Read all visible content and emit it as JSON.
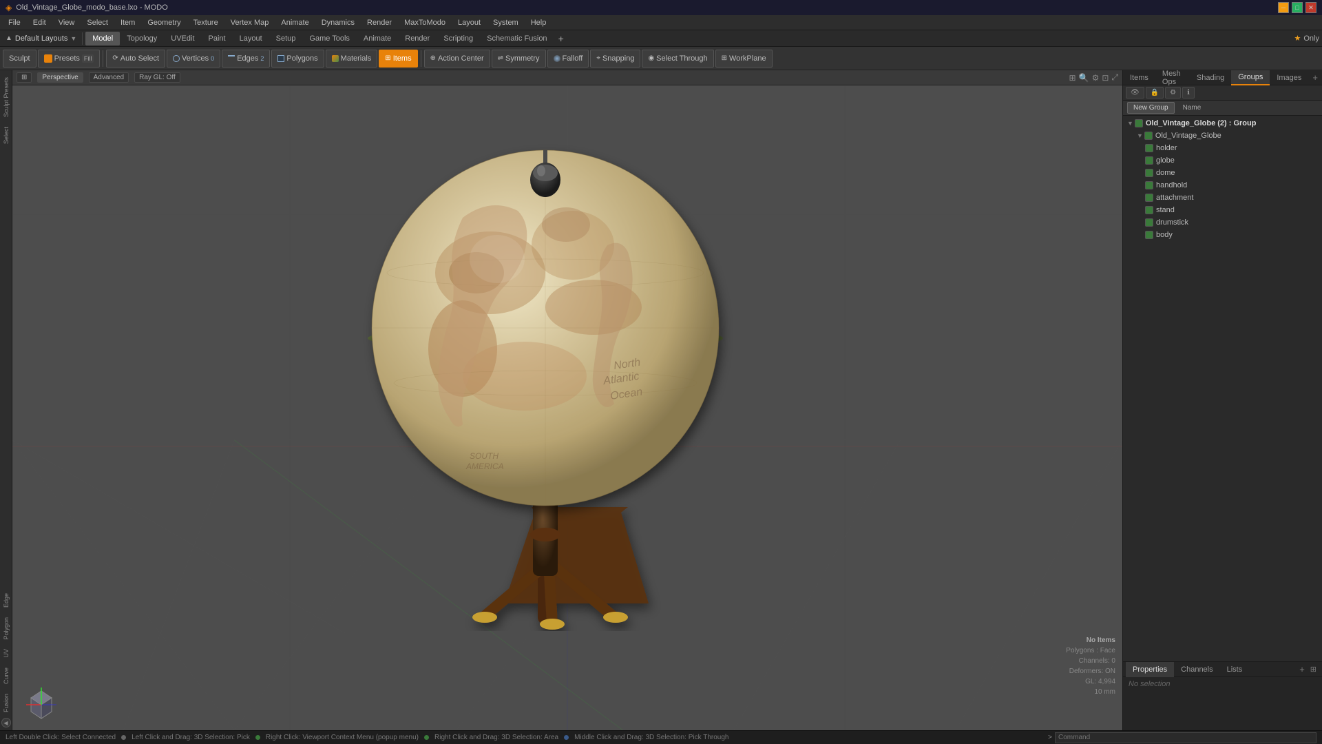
{
  "window": {
    "title": "Old_Vintage_Globe_modo_base.lxo - MODO",
    "min_label": "─",
    "max_label": "□",
    "close_label": "✕"
  },
  "menubar": {
    "items": [
      "File",
      "Edit",
      "View",
      "Select",
      "Item",
      "Geometry",
      "Texture",
      "Vertex Map",
      "Animate",
      "Dynamics",
      "Render",
      "MaxToModo",
      "Layout",
      "System",
      "Help"
    ]
  },
  "layoutbar": {
    "layouts_label": "Default Layouts",
    "tabs": [
      "Model",
      "Topology",
      "UVEdit",
      "Paint",
      "Layout",
      "Setup",
      "Game Tools",
      "Animate",
      "Render",
      "Scripting",
      "Schematic Fusion"
    ],
    "active_tab": "Model",
    "star_label": "★  Only",
    "add_label": "+"
  },
  "toolbar": {
    "sculpt_label": "Sculpt",
    "presets_label": "Presets",
    "presets_extra": "Fill",
    "autoselect_label": "Auto Select",
    "vertices_label": "Vertices",
    "vertices_num": "0",
    "edges_label": "Edges",
    "edges_num": "2",
    "polygons_label": "Polygons",
    "materials_label": "Materials",
    "items_label": "Items",
    "action_center_label": "Action Center",
    "symmetry_label": "Symmetry",
    "falloff_label": "Falloff",
    "snapping_label": "Snapping",
    "select_through_label": "Select Through",
    "workplane_label": "WorkPlane"
  },
  "viewport": {
    "perspective_label": "Perspective",
    "advanced_label": "Advanced",
    "ray_gl_label": "Ray GL: Off"
  },
  "globe": {
    "ocean_text": "North Atlantic Ocean",
    "globe_label": "Old Vintage Globe 3D model"
  },
  "info_overlay": {
    "no_items": "No Items",
    "polygons": "Polygons : Face",
    "channels": "Channels: 0",
    "deformers": "Deformers: ON",
    "gl": "GL: 4,994",
    "unit": "10 mm"
  },
  "right_panel": {
    "tabs": [
      "Items",
      "Mesh Ops",
      "Shading",
      "Groups",
      "Images"
    ],
    "active_tab": "Groups",
    "add_label": "+",
    "new_group_label": "New Group",
    "name_col": "Name",
    "scene_tree": {
      "root": {
        "label": "Old_Vintage_Globe (2) : Group",
        "expanded": true,
        "children": [
          {
            "label": "Old_Vintage_Globe",
            "indent": 1,
            "eye": true
          },
          {
            "label": "holder",
            "indent": 2,
            "eye": true
          },
          {
            "label": "globe",
            "indent": 2,
            "eye": true
          },
          {
            "label": "dome",
            "indent": 2,
            "eye": true
          },
          {
            "label": "handhold",
            "indent": 2,
            "eye": true
          },
          {
            "label": "attachment",
            "indent": 2,
            "eye": true
          },
          {
            "label": "stand",
            "indent": 2,
            "eye": true
          },
          {
            "label": "drumstick",
            "indent": 2,
            "eye": true
          },
          {
            "label": "body",
            "indent": 2,
            "eye": true
          }
        ]
      }
    }
  },
  "bottom_panel": {
    "tabs": [
      "Properties",
      "Channels",
      "Lists"
    ],
    "active_tab": "Properties",
    "add_label": "+",
    "expand_label": "⊞"
  },
  "statusbar": {
    "tip": "Left Double Click: Select Connected",
    "dot1_label": "Left Click and Drag: 3D Selection: Pick",
    "dot2_label": "Right Click: Viewport Context Menu (popup menu)",
    "dot3_label": "Right Click and Drag: 3D Selection: Area",
    "dot4_label": "Middle Click and Drag: 3D Selection: Pick Through",
    "command_prompt": ">",
    "command_placeholder": "Command"
  },
  "colors": {
    "accent_orange": "#e8820a",
    "active_blue": "#3a6ea8",
    "bg_dark": "#1e1e1e",
    "bg_panel": "#2d2d2d",
    "bg_viewport": "#4d4d4d",
    "eye_green": "#3a7a3a",
    "grid_line": "#5a5a5a"
  }
}
